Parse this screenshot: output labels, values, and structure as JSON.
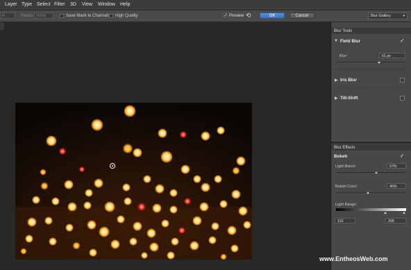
{
  "menubar": {
    "items": [
      "Layer",
      "Type",
      "Select",
      "Filter",
      "3D",
      "View",
      "Window",
      "Help"
    ]
  },
  "options_bar": {
    "mode_partial": "lo",
    "focus_label": "Focus:",
    "focus_value": "100%",
    "save_mask_label": "Save Mask to Channels",
    "high_quality_label": "High Quality",
    "preview_label": "Preview",
    "ok_label": "OK",
    "cancel_label": "Cancel",
    "workspace_select": "Blur Gallery"
  },
  "blur_tools": {
    "header": "Blur Tools",
    "field_blur": {
      "title": "Field Blur",
      "checked": true,
      "blur_label": "Blur:",
      "blur_value": "61 px",
      "blur_fraction": 0.61
    },
    "iris_blur": {
      "title": "Iris Blur",
      "checked": false
    },
    "tilt_shift": {
      "title": "Tilt-Shift",
      "checked": false
    }
  },
  "blur_effects": {
    "header": "Blur Effects",
    "bokeh": {
      "title": "Bokeh",
      "checked": true
    },
    "light_bokeh": {
      "label": "Light Bokeh:",
      "value": "57%",
      "fraction": 0.57
    },
    "bokeh_color": {
      "label": "Bokeh Color:",
      "value": "46%",
      "fraction": 0.46
    },
    "light_range": {
      "label": "Light Range:",
      "low": "191",
      "high": "255"
    }
  },
  "watermark": "www.EntheosWeb.com",
  "colors": {
    "ok_button": "#3a6fb5",
    "panel_bg": "#484848",
    "canvas_bg": "#282828"
  }
}
